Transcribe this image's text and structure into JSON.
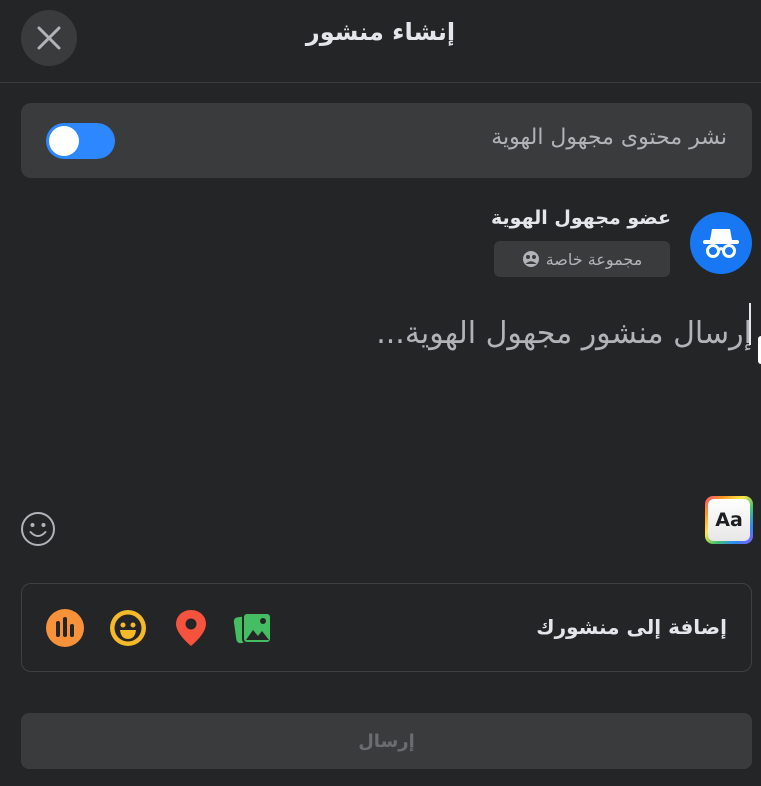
{
  "header": {
    "title": "إنشاء منشور"
  },
  "anonymous": {
    "label": "نشر محتوى مجهول الهوية",
    "enabled": true
  },
  "author": {
    "name": "عضو مجهول الهوية",
    "audience": "مجموعة خاصة"
  },
  "composer": {
    "placeholder": "إرسال منشور مجهول الهوية...",
    "value": ""
  },
  "add_to_post": {
    "label": "إضافة إلى منشورك",
    "icons": [
      "photo-video-icon",
      "location-icon",
      "feeling-icon",
      "poll-icon"
    ]
  },
  "text_style_button": {
    "label": "Aa"
  },
  "submit": {
    "label": "إرسال"
  },
  "colors": {
    "background": "#242526",
    "surface": "#3a3b3c",
    "accent": "#2d88ff",
    "photo": "#45bd62",
    "location": "#f5533d",
    "feeling": "#f7b928",
    "poll": "#f7923b"
  }
}
